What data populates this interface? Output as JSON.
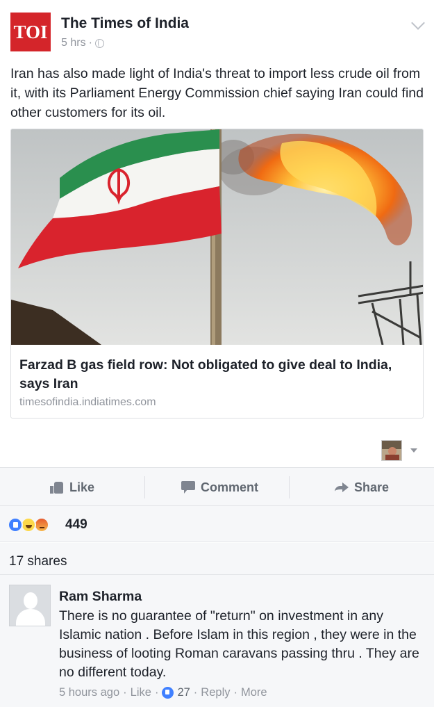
{
  "post": {
    "page_name": "The Times of India",
    "logo_text": "TOI",
    "time": "5 hrs",
    "time_separator": "·",
    "text": "Iran has also made light of India's threat to import less crude oil from it, with its Parliament Energy Commission chief saying Iran could find other customers for its oil."
  },
  "link_card": {
    "title": "Farzad B gas field row: Not obligated to give deal to India, says Iran",
    "domain": "timesofindia.indiatimes.com"
  },
  "actions": {
    "like_label": "Like",
    "comment_label": "Comment",
    "share_label": "Share"
  },
  "reactions": {
    "count": "449",
    "icons": [
      "like-reaction-icon",
      "haha-reaction-icon",
      "angry-reaction-icon"
    ]
  },
  "shares": {
    "text": "17 shares"
  },
  "comment": {
    "author": "Ram Sharma",
    "text": "There is no guarantee of \"return\" on investment in any Islamic nation . Before Islam in this region , they were in the business of looting Roman caravans passing thru . They are no different today.",
    "time": "5 hours ago",
    "like_label": "Like",
    "like_count": "27",
    "reply_label": "Reply",
    "more_label": "More",
    "separator": "·"
  },
  "colors": {
    "logo_red": "#d4252a",
    "facebook_blue": "#4080ff",
    "meta_gray": "#90949c"
  }
}
